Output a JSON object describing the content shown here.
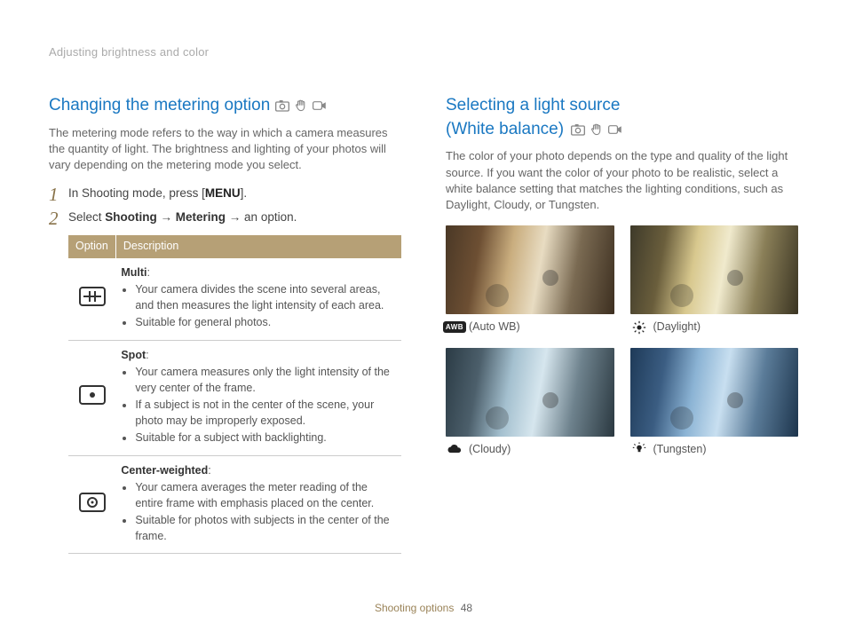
{
  "breadcrumb": "Adjusting brightness and color",
  "left": {
    "heading": "Changing the metering option",
    "intro": "The metering mode refers to the way in which a camera measures the quantity of light. The brightness and lighting of your photos will vary depending on the metering mode you select.",
    "step1_pre": "In Shooting mode, press [",
    "step1_key": "MENU",
    "step1_post": "].",
    "step2_pre": "Select ",
    "step2_b1": "Shooting",
    "step2_arrow1": " → ",
    "step2_b2": "Metering",
    "step2_arrow2": " → an option.",
    "th_option": "Option",
    "th_desc": "Description",
    "rows": [
      {
        "name": "Multi",
        "bullets": [
          "Your camera divides the scene into several areas, and then measures the light intensity of each area.",
          "Suitable for general photos."
        ]
      },
      {
        "name": "Spot",
        "bullets": [
          "Your camera measures only the light intensity of the very center of the frame.",
          "If a subject is not in the center of the scene, your photo may be improperly exposed.",
          "Suitable for a subject with backlighting."
        ]
      },
      {
        "name": "Center-weighted",
        "bullets": [
          "Your camera averages the meter reading of the entire frame with emphasis placed on the center.",
          "Suitable for photos with subjects in the center of the frame."
        ]
      }
    ]
  },
  "right": {
    "heading_l1": "Selecting a light source",
    "heading_l2": "(White balance)",
    "intro": "The color of your photo depends on the type and quality of the light source. If you want the color of your photo to be realistic, select a white balance setting that matches the lighting conditions, such as Daylight, Cloudy, or Tungsten.",
    "wb": {
      "auto_badge": "AWB",
      "auto": "(Auto WB)",
      "daylight": "(Daylight)",
      "cloudy": "(Cloudy)",
      "tungsten": "(Tungsten)"
    }
  },
  "footer": {
    "section": "Shooting options",
    "page": "48"
  }
}
